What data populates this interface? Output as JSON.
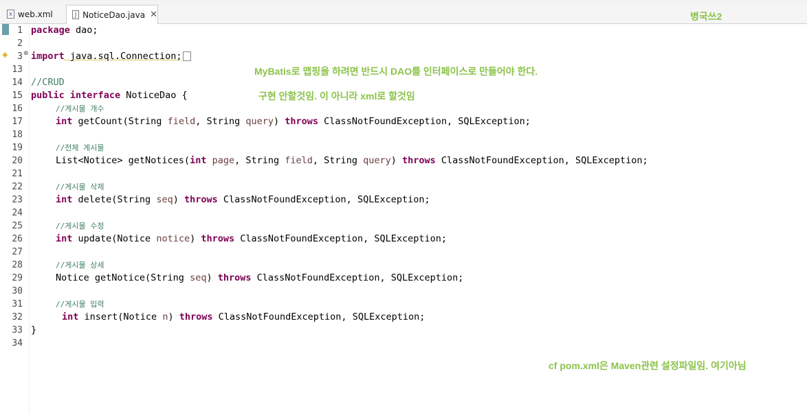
{
  "editor": {
    "tabs": [
      {
        "label": "web.xml",
        "icon": "xml-file-icon",
        "active": false
      },
      {
        "label": "NoticeDao.java",
        "icon": "java-file-icon",
        "active": true
      }
    ]
  },
  "annotations": {
    "top_right": "병국쓰2",
    "mybatis_note": "MyBatis로 맵핑을 하려면 반드시 DAO를 인터페이스로 만들어야 한다.",
    "impl_note": "구현 안할것임. 이 아니라 xml로 할것임",
    "pom_note": "cf pom.xml은 Maven관련 설정파일임. 여기아님"
  },
  "code": {
    "line_numbers": [
      "1",
      "2",
      "3",
      "13",
      "14",
      "15",
      "16",
      "17",
      "18",
      "19",
      "20",
      "21",
      "22",
      "23",
      "24",
      "25",
      "26",
      "27",
      "28",
      "29",
      "30",
      "31",
      "32",
      "33",
      "34"
    ],
    "l1_kw": "package",
    "l1_rest": " dao;",
    "l3_kw": "import",
    "l3_rest": " java.sql.Connection;",
    "l14": "//CRUD",
    "l15_kw1": "public",
    "l15_kw2": "interface",
    "l15_rest": " NoticeDao {",
    "l16": "//게시물 개수",
    "l17_kw": "int",
    "l17_a": " getCount(String ",
    "l17_p1": "field",
    "l17_b": ", String ",
    "l17_p2": "query",
    "l17_c": ") ",
    "l17_kw2": "throws",
    "l17_d": " ClassNotFoundException, SQLException;",
    "l19": "//전체 게시물",
    "l20_a": "List<Notice> getNotices(",
    "l20_kw": "int",
    "l20_b": " ",
    "l20_p1": "page",
    "l20_c": ", String ",
    "l20_p2": "field",
    "l20_d": ", String ",
    "l20_p3": "query",
    "l20_e": ") ",
    "l20_kw2": "throws",
    "l20_f": " ClassNotFoundException, SQLException;",
    "l22": "//게시물 삭제",
    "l23_kw": "int",
    "l23_a": " delete(String ",
    "l23_p1": "seq",
    "l23_b": ") ",
    "l23_kw2": "throws",
    "l23_c": " ClassNotFoundException, SQLException;",
    "l25": "//게시물 수정",
    "l26_kw": "int",
    "l26_a": " update(Notice ",
    "l26_p1": "notice",
    "l26_b": ") ",
    "l26_kw2": "throws",
    "l26_c": " ClassNotFoundException, SQLException;",
    "l28": "//게시물 상세",
    "l29_a": "Notice getNotice(String ",
    "l29_p1": "seq",
    "l29_b": ") ",
    "l29_kw2": "throws",
    "l29_c": " ClassNotFoundException, SQLException;",
    "l31": "//게시물 입력",
    "l32_kw": "int",
    "l32_a": " insert(Notice ",
    "l32_p1": "n",
    "l32_b": ") ",
    "l32_kw2": "throws",
    "l32_c": " ClassNotFoundException, SQLException;",
    "l33": "}"
  },
  "colors": {
    "keyword": "#7f0055",
    "comment": "#3f7f5f",
    "annotation": "#8bc34a"
  }
}
